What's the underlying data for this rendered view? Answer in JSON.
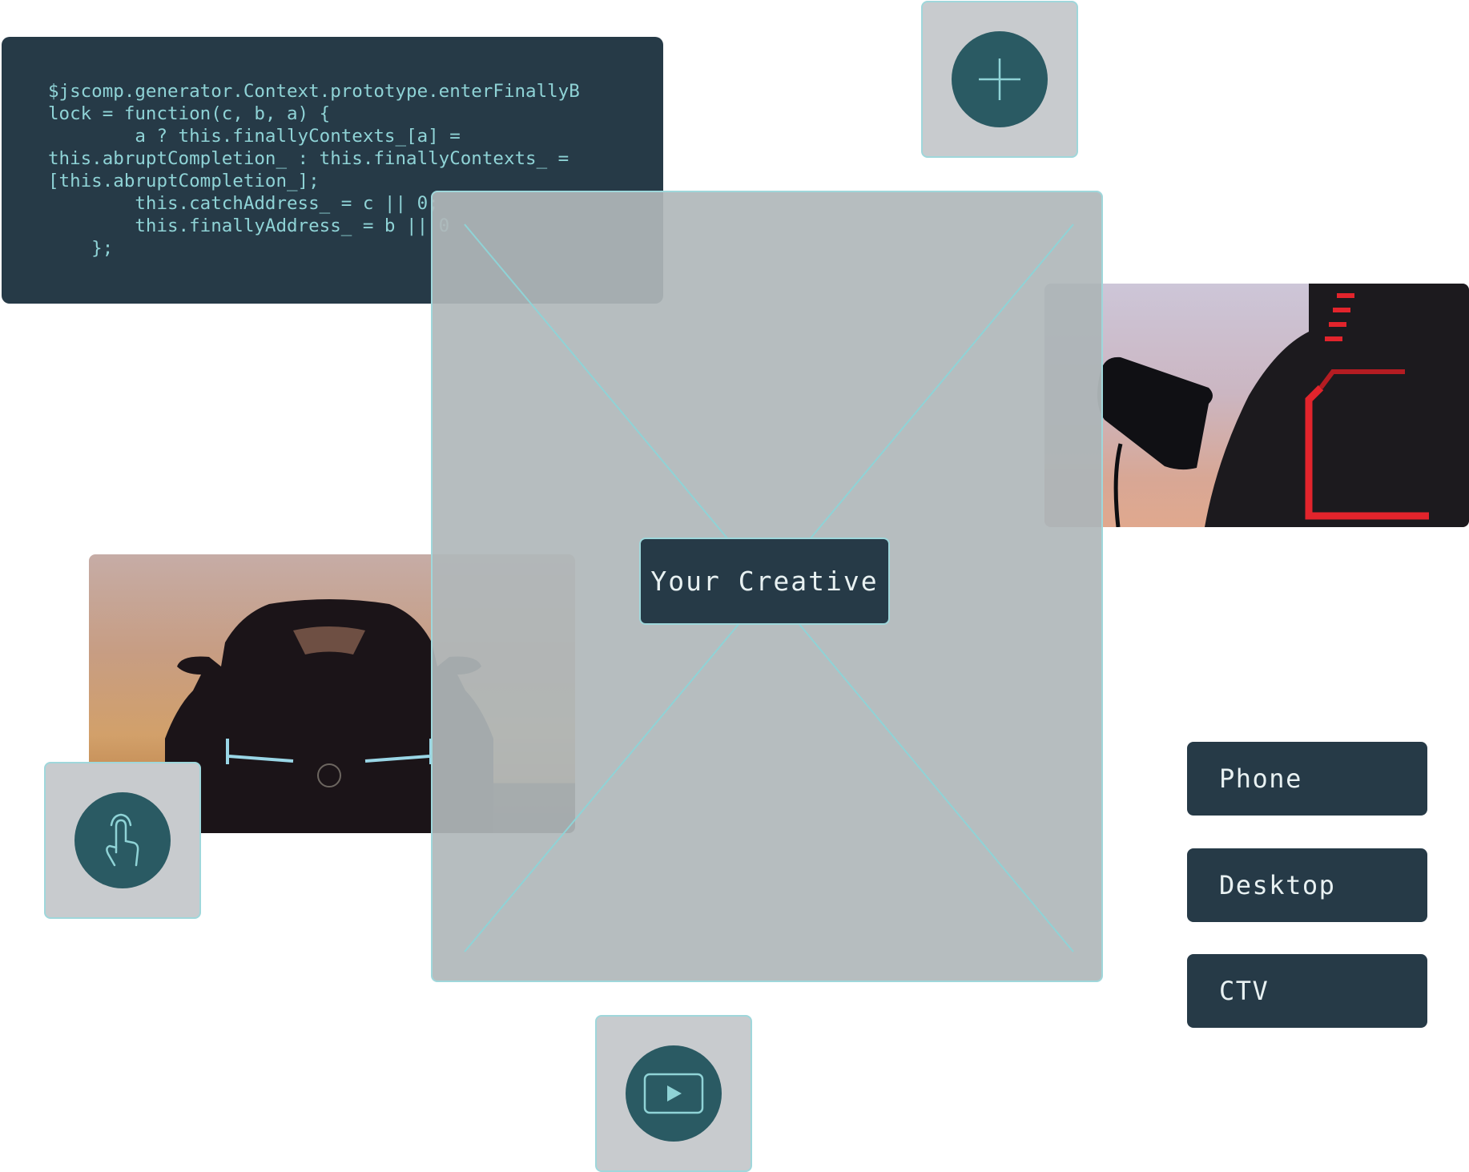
{
  "code_panel": {
    "code": "$jscomp.generator.Context.prototype.enterFinallyB\nlock = function(c, b, a) {\n        a ? this.finallyContexts_[a] =\nthis.abruptCompletion_ : this.finallyContexts_ =\n[this.abruptCompletion_];\n        this.catchAddress_ = c || 0;\n        this.finallyAddress_ = b || 0\n    };"
  },
  "creative": {
    "label": "Your Creative"
  },
  "devices": [
    {
      "label": "Phone"
    },
    {
      "label": "Desktop"
    },
    {
      "label": "CTV"
    }
  ],
  "icons": {
    "add": "plus-icon",
    "touch": "tap-gesture-icon",
    "video": "video-play-icon"
  },
  "colors": {
    "panel_dark": "#263a47",
    "accent_teal": "#2a5a63",
    "outline_cyan": "#9fd7db",
    "code_text": "#8fd3d6",
    "placeholder_gray": "#b0b7ba"
  }
}
